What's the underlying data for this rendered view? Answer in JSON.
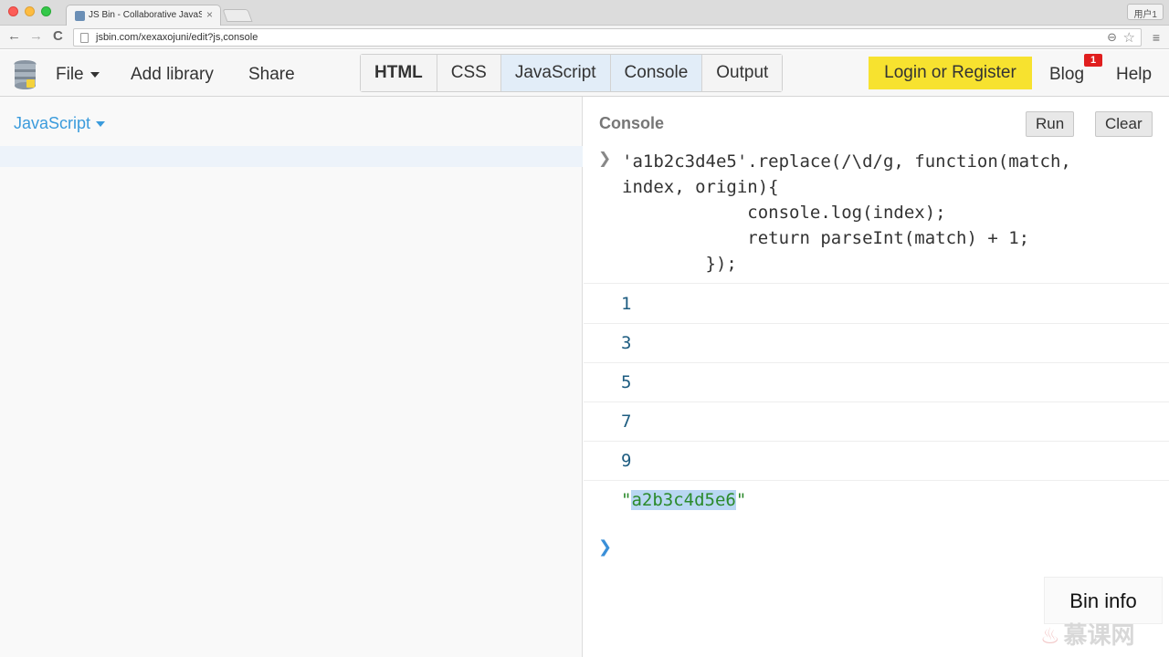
{
  "browser": {
    "tab_title": "JS Bin - Collaborative JavaScript Debugging",
    "tab_close": "×",
    "user_label": "用户1",
    "url": "jsbin.com/xexaxojuni/edit?js,console",
    "back_glyph": "←",
    "forward_glyph": "→",
    "reload_glyph": "C",
    "zoom_glyph": "⊖",
    "star_glyph": "☆",
    "menu_glyph": "≡"
  },
  "toolbar": {
    "file_label": "File",
    "add_library_label": "Add library",
    "share_label": "Share",
    "panels": [
      "HTML",
      "CSS",
      "JavaScript",
      "Console",
      "Output"
    ],
    "login_label": "Login or Register",
    "blog_label": "Blog",
    "blog_badge": "1",
    "help_label": "Help"
  },
  "js_pane": {
    "label": "JavaScript"
  },
  "console": {
    "title": "Console",
    "run_label": "Run",
    "clear_label": "Clear",
    "prompt_glyph": "❯",
    "code_lines": [
      "'a1b2c3d4e5'.replace(/\\d/g, function(match,",
      "index, origin){",
      "            console.log(index);",
      "            return parseInt(match) + 1;",
      "        });"
    ],
    "outputs": [
      "1",
      "3",
      "5",
      "7",
      "9"
    ],
    "result_quote": "\"",
    "result_value": "a2b3c4d5e6"
  },
  "bin_info_label": "Bin info",
  "watermark_text": "慕课网",
  "colors": {
    "accent_blue": "#3a9bdc",
    "login_yellow": "#f7e22f",
    "badge_red": "#e01e1e",
    "string_green": "#2b8a2b",
    "number_blue": "#1d5c80"
  }
}
